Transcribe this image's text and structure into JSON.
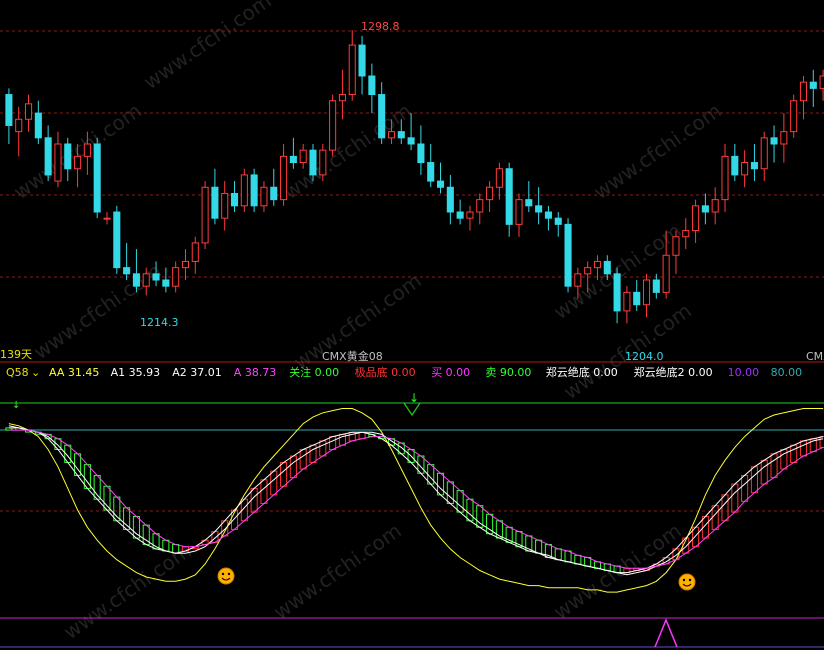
{
  "main_panel": {
    "high_label": "1298.8",
    "low_label_left": "1214.3",
    "low_label_right": "1204.0",
    "period_label": "139天",
    "axis_marker_center": "CMX黄金08",
    "axis_marker_right": "CMX",
    "watermark": "www.cfchi.com",
    "colors": {
      "up": "#ff3b3b",
      "down": "#33d9e6",
      "grid": "#8b1a1a",
      "axis": "#b01818"
    }
  },
  "indicator_header": {
    "name": "Q58",
    "items": [
      {
        "label": "AA",
        "value": "31.45",
        "color": "#ffff33"
      },
      {
        "label": "A1",
        "value": "35.93",
        "color": "#ffffff"
      },
      {
        "label": "A2",
        "value": "37.01",
        "color": "#ffffff"
      },
      {
        "label": "A",
        "value": "38.73",
        "color": "#ff44ff"
      },
      {
        "label": "关注",
        "value": "0.00",
        "color": "#33ff33"
      },
      {
        "label": "极品底",
        "value": "0.00",
        "color": "#ff3333"
      },
      {
        "label": "买",
        "value": "0.00",
        "color": "#ff33ff"
      },
      {
        "label": "卖",
        "value": "90.00",
        "color": "#33ff33"
      },
      {
        "label": "郑云绝底",
        "value": "0.00",
        "color": "#ffffff"
      },
      {
        "label": "郑云绝底2",
        "value": "0.00",
        "color": "#ffffff"
      },
      {
        "label": "",
        "value": "10.00",
        "color": "#9933ff"
      },
      {
        "label": "",
        "value": "80.00",
        "color": "#33aaaa"
      }
    ]
  },
  "chart_data": [
    {
      "type": "candlestick",
      "title": "CMX黄金08",
      "x": [
        1,
        2,
        3,
        4,
        5,
        6,
        7,
        8,
        9,
        10,
        11,
        12,
        13,
        14,
        15,
        16,
        17,
        18,
        19,
        20,
        21,
        22,
        23,
        24,
        25,
        26,
        27,
        28,
        29,
        30,
        31,
        32,
        33,
        34,
        35,
        36,
        37,
        38,
        39,
        40,
        41,
        42,
        43,
        44,
        45,
        46,
        47,
        48,
        49,
        50,
        51,
        52,
        53,
        54,
        55,
        56,
        57,
        58,
        59,
        60,
        61,
        62,
        63,
        64,
        65,
        66,
        67,
        68,
        69,
        70,
        71,
        72,
        73,
        74,
        75,
        76,
        77,
        78,
        79,
        80,
        81,
        82,
        83,
        84
      ],
      "ohlc": [
        [
          1278,
          1280,
          1262,
          1268
        ],
        [
          1266,
          1274,
          1258,
          1270
        ],
        [
          1270,
          1278,
          1266,
          1275
        ],
        [
          1272,
          1276,
          1262,
          1264
        ],
        [
          1264,
          1268,
          1250,
          1252
        ],
        [
          1250,
          1266,
          1248,
          1262
        ],
        [
          1262,
          1264,
          1250,
          1254
        ],
        [
          1254,
          1262,
          1248,
          1258
        ],
        [
          1258,
          1266,
          1252,
          1262
        ],
        [
          1262,
          1264,
          1238,
          1240
        ],
        [
          1238,
          1240,
          1236,
          1238
        ],
        [
          1240,
          1242,
          1220,
          1222
        ],
        [
          1222,
          1230,
          1218,
          1220
        ],
        [
          1220,
          1228,
          1214,
          1216
        ],
        [
          1216,
          1222,
          1213,
          1220
        ],
        [
          1220,
          1224,
          1216,
          1218
        ],
        [
          1218,
          1222,
          1214,
          1216
        ],
        [
          1216,
          1224,
          1214,
          1222
        ],
        [
          1222,
          1228,
          1218,
          1224
        ],
        [
          1224,
          1232,
          1220,
          1230
        ],
        [
          1230,
          1250,
          1228,
          1248
        ],
        [
          1248,
          1254,
          1236,
          1238
        ],
        [
          1238,
          1250,
          1234,
          1246
        ],
        [
          1246,
          1250,
          1240,
          1242
        ],
        [
          1242,
          1254,
          1240,
          1252
        ],
        [
          1252,
          1254,
          1240,
          1242
        ],
        [
          1242,
          1250,
          1240,
          1248
        ],
        [
          1248,
          1254,
          1242,
          1244
        ],
        [
          1244,
          1262,
          1242,
          1258
        ],
        [
          1258,
          1264,
          1254,
          1256
        ],
        [
          1256,
          1262,
          1254,
          1260
        ],
        [
          1260,
          1262,
          1250,
          1252
        ],
        [
          1252,
          1262,
          1250,
          1260
        ],
        [
          1260,
          1278,
          1258,
          1276
        ],
        [
          1276,
          1286,
          1270,
          1278
        ],
        [
          1278,
          1298.8,
          1276,
          1294
        ],
        [
          1294,
          1297,
          1278,
          1284
        ],
        [
          1284,
          1288,
          1272,
          1278
        ],
        [
          1278,
          1282,
          1262,
          1264
        ],
        [
          1264,
          1270,
          1262,
          1266
        ],
        [
          1266,
          1270,
          1262,
          1264
        ],
        [
          1264,
          1272,
          1260,
          1262
        ],
        [
          1262,
          1268,
          1252,
          1256
        ],
        [
          1256,
          1262,
          1248,
          1250
        ],
        [
          1250,
          1256,
          1246,
          1248
        ],
        [
          1248,
          1252,
          1236,
          1240
        ],
        [
          1240,
          1244,
          1236,
          1238
        ],
        [
          1238,
          1242,
          1234,
          1240
        ],
        [
          1240,
          1246,
          1236,
          1244
        ],
        [
          1244,
          1250,
          1240,
          1248
        ],
        [
          1248,
          1256,
          1244,
          1254
        ],
        [
          1254,
          1256,
          1232,
          1236
        ],
        [
          1236,
          1246,
          1232,
          1244
        ],
        [
          1244,
          1250,
          1240,
          1242
        ],
        [
          1242,
          1248,
          1236,
          1240
        ],
        [
          1240,
          1242,
          1234,
          1238
        ],
        [
          1238,
          1240,
          1232,
          1236
        ],
        [
          1236,
          1238,
          1214,
          1216
        ],
        [
          1216,
          1222,
          1212,
          1220
        ],
        [
          1220,
          1224,
          1214,
          1222
        ],
        [
          1222,
          1226,
          1218,
          1224
        ],
        [
          1224,
          1226,
          1218,
          1220
        ],
        [
          1220,
          1222,
          1204,
          1208
        ],
        [
          1208,
          1216,
          1204,
          1214
        ],
        [
          1214,
          1218,
          1208,
          1210
        ],
        [
          1210,
          1220,
          1206,
          1218
        ],
        [
          1218,
          1220,
          1212,
          1214
        ],
        [
          1214,
          1234,
          1212,
          1226
        ],
        [
          1226,
          1234,
          1220,
          1232
        ],
        [
          1232,
          1238,
          1228,
          1234
        ],
        [
          1234,
          1244,
          1230,
          1242
        ],
        [
          1242,
          1246,
          1236,
          1240
        ],
        [
          1240,
          1248,
          1236,
          1244
        ],
        [
          1244,
          1262,
          1240,
          1258
        ],
        [
          1258,
          1262,
          1250,
          1252
        ],
        [
          1252,
          1260,
          1248,
          1256
        ],
        [
          1256,
          1262,
          1250,
          1254
        ],
        [
          1254,
          1266,
          1250,
          1264
        ],
        [
          1264,
          1268,
          1256,
          1262
        ],
        [
          1262,
          1272,
          1256,
          1266
        ],
        [
          1266,
          1278,
          1264,
          1276
        ],
        [
          1276,
          1284,
          1270,
          1282
        ],
        [
          1282,
          1286,
          1274,
          1280
        ],
        [
          1280,
          1286,
          1276,
          1284
        ]
      ],
      "annotations": [
        {
          "text": "1298.8",
          "x": 36,
          "y": 1298.8
        },
        {
          "text": "1214.3",
          "x": 14,
          "y": 1214.3
        },
        {
          "text": "1204.0",
          "x": 63,
          "y": 1204.0
        }
      ],
      "ylim": [
        1196,
        1306
      ],
      "grid": true
    },
    {
      "type": "line",
      "title": "Q58",
      "ylim": [
        0,
        100
      ],
      "x": [
        1,
        2,
        3,
        4,
        5,
        6,
        7,
        8,
        9,
        10,
        11,
        12,
        13,
        14,
        15,
        16,
        17,
        18,
        19,
        20,
        21,
        22,
        23,
        24,
        25,
        26,
        27,
        28,
        29,
        30,
        31,
        32,
        33,
        34,
        35,
        36,
        37,
        38,
        39,
        40,
        41,
        42,
        43,
        44,
        45,
        46,
        47,
        48,
        49,
        50,
        51,
        52,
        53,
        54,
        55,
        56,
        57,
        58,
        59,
        60,
        61,
        62,
        63,
        64,
        65,
        66,
        67,
        68,
        69,
        70,
        71,
        72,
        73,
        74,
        75,
        76,
        77,
        78,
        79,
        80,
        81,
        82,
        83,
        84
      ],
      "series": [
        {
          "name": "AA",
          "color": "#ffff33",
          "values": [
            90,
            89,
            87,
            84,
            78,
            70,
            60,
            50,
            42,
            36,
            31,
            27,
            24,
            21,
            19,
            18,
            17,
            17,
            18,
            20,
            25,
            32,
            40,
            49,
            57,
            64,
            70,
            75,
            80,
            85,
            90,
            93,
            95,
            96,
            97,
            97,
            95,
            92,
            86,
            78,
            69,
            60,
            51,
            43,
            37,
            32,
            28,
            25,
            22,
            20,
            18,
            17,
            16,
            15,
            15,
            14,
            14,
            14,
            14,
            13,
            13,
            12,
            12,
            13,
            14,
            15,
            17,
            21,
            27,
            36,
            46,
            57,
            66,
            73,
            79,
            84,
            88,
            92,
            94,
            95,
            96,
            97,
            97,
            97
          ]
        },
        {
          "name": "A1",
          "color": "#ffffff",
          "values": [
            88,
            88,
            87,
            86,
            83,
            78,
            72,
            66,
            60,
            55,
            50,
            45,
            41,
            37,
            34,
            32,
            31,
            30,
            31,
            33,
            36,
            40,
            45,
            50,
            55,
            60,
            64,
            68,
            72,
            75,
            78,
            80,
            82,
            84,
            85,
            86,
            86,
            85,
            83,
            80,
            76,
            72,
            67,
            62,
            57,
            53,
            49,
            45,
            42,
            39,
            37,
            35,
            33,
            31,
            30,
            28,
            27,
            26,
            25,
            24,
            23,
            22,
            21,
            21,
            22,
            23,
            25,
            28,
            32,
            37,
            42,
            47,
            52,
            57,
            62,
            66,
            70,
            73,
            76,
            78,
            80,
            82,
            83,
            84
          ]
        },
        {
          "name": "A2",
          "color": "#ffffff",
          "values": [
            89,
            88,
            87,
            86,
            84,
            80,
            75,
            69,
            63,
            57,
            52,
            47,
            43,
            39,
            36,
            33,
            31,
            30,
            30,
            31,
            33,
            37,
            41,
            46,
            51,
            56,
            60,
            64,
            68,
            72,
            75,
            78,
            80,
            82,
            84,
            85,
            86,
            86,
            85,
            82,
            79,
            75,
            70,
            65,
            60,
            56,
            52,
            48,
            44,
            41,
            38,
            36,
            34,
            32,
            30,
            29,
            27,
            26,
            25,
            24,
            23,
            22,
            21,
            20,
            21,
            22,
            24,
            26,
            29,
            33,
            38,
            43,
            48,
            53,
            58,
            62,
            66,
            70,
            73,
            76,
            78,
            80,
            82,
            83
          ]
        },
        {
          "name": "A",
          "color": "#ff44ff",
          "values": [
            87,
            87,
            87,
            86,
            85,
            83,
            80,
            76,
            71,
            66,
            61,
            56,
            51,
            47,
            43,
            39,
            36,
            34,
            33,
            33,
            34,
            35,
            38,
            41,
            45,
            49,
            53,
            57,
            61,
            65,
            69,
            72,
            75,
            78,
            80,
            82,
            83,
            84,
            84,
            83,
            81,
            78,
            75,
            71,
            67,
            63,
            59,
            55,
            52,
            48,
            45,
            42,
            40,
            38,
            36,
            34,
            32,
            31,
            29,
            28,
            26,
            25,
            24,
            23,
            23,
            23,
            24,
            25,
            27,
            30,
            33,
            37,
            41,
            45,
            49,
            54,
            58,
            62,
            65,
            69,
            72,
            75,
            77,
            79
          ]
        }
      ]
    }
  ]
}
